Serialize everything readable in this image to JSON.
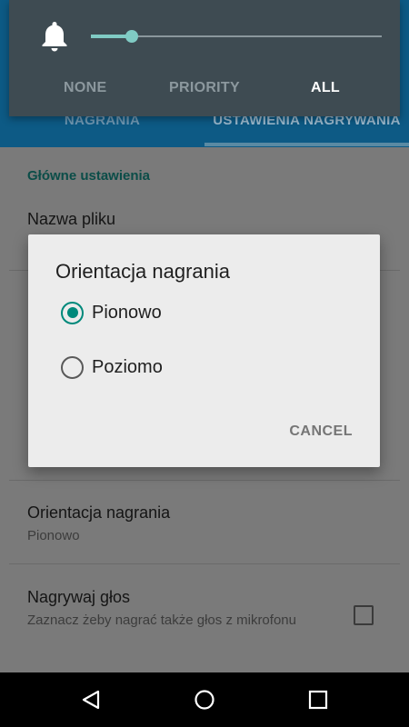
{
  "tabs": [
    {
      "label": "NAGRANIA"
    },
    {
      "label": "USTAWIENIA NAGRYWANIA"
    }
  ],
  "settings": {
    "section_header": "Główne ustawienia",
    "file_name": {
      "title": "Nazwa pliku"
    },
    "orientation": {
      "title": "Orientacja nagrania",
      "summary": "Pionowo"
    },
    "record_voice": {
      "title": "Nagrywaj głos",
      "summary": "Zaznacz żeby nagrać także głos z mikrofonu",
      "checked": false
    }
  },
  "volume_panel": {
    "icon": "bell-icon",
    "level": 0.14,
    "modes": [
      "NONE",
      "PRIORITY",
      "ALL"
    ],
    "active_mode": "ALL",
    "accent_color": "#80cbc4"
  },
  "dialog": {
    "title": "Orientacja nagrania",
    "options": [
      {
        "label": "Pionowo",
        "selected": true
      },
      {
        "label": "Poziomo",
        "selected": false
      }
    ],
    "cancel_label": "CANCEL",
    "accent_color": "#00897b"
  },
  "nav_bar": {
    "icons": [
      "back-icon",
      "home-icon",
      "recents-icon"
    ]
  }
}
